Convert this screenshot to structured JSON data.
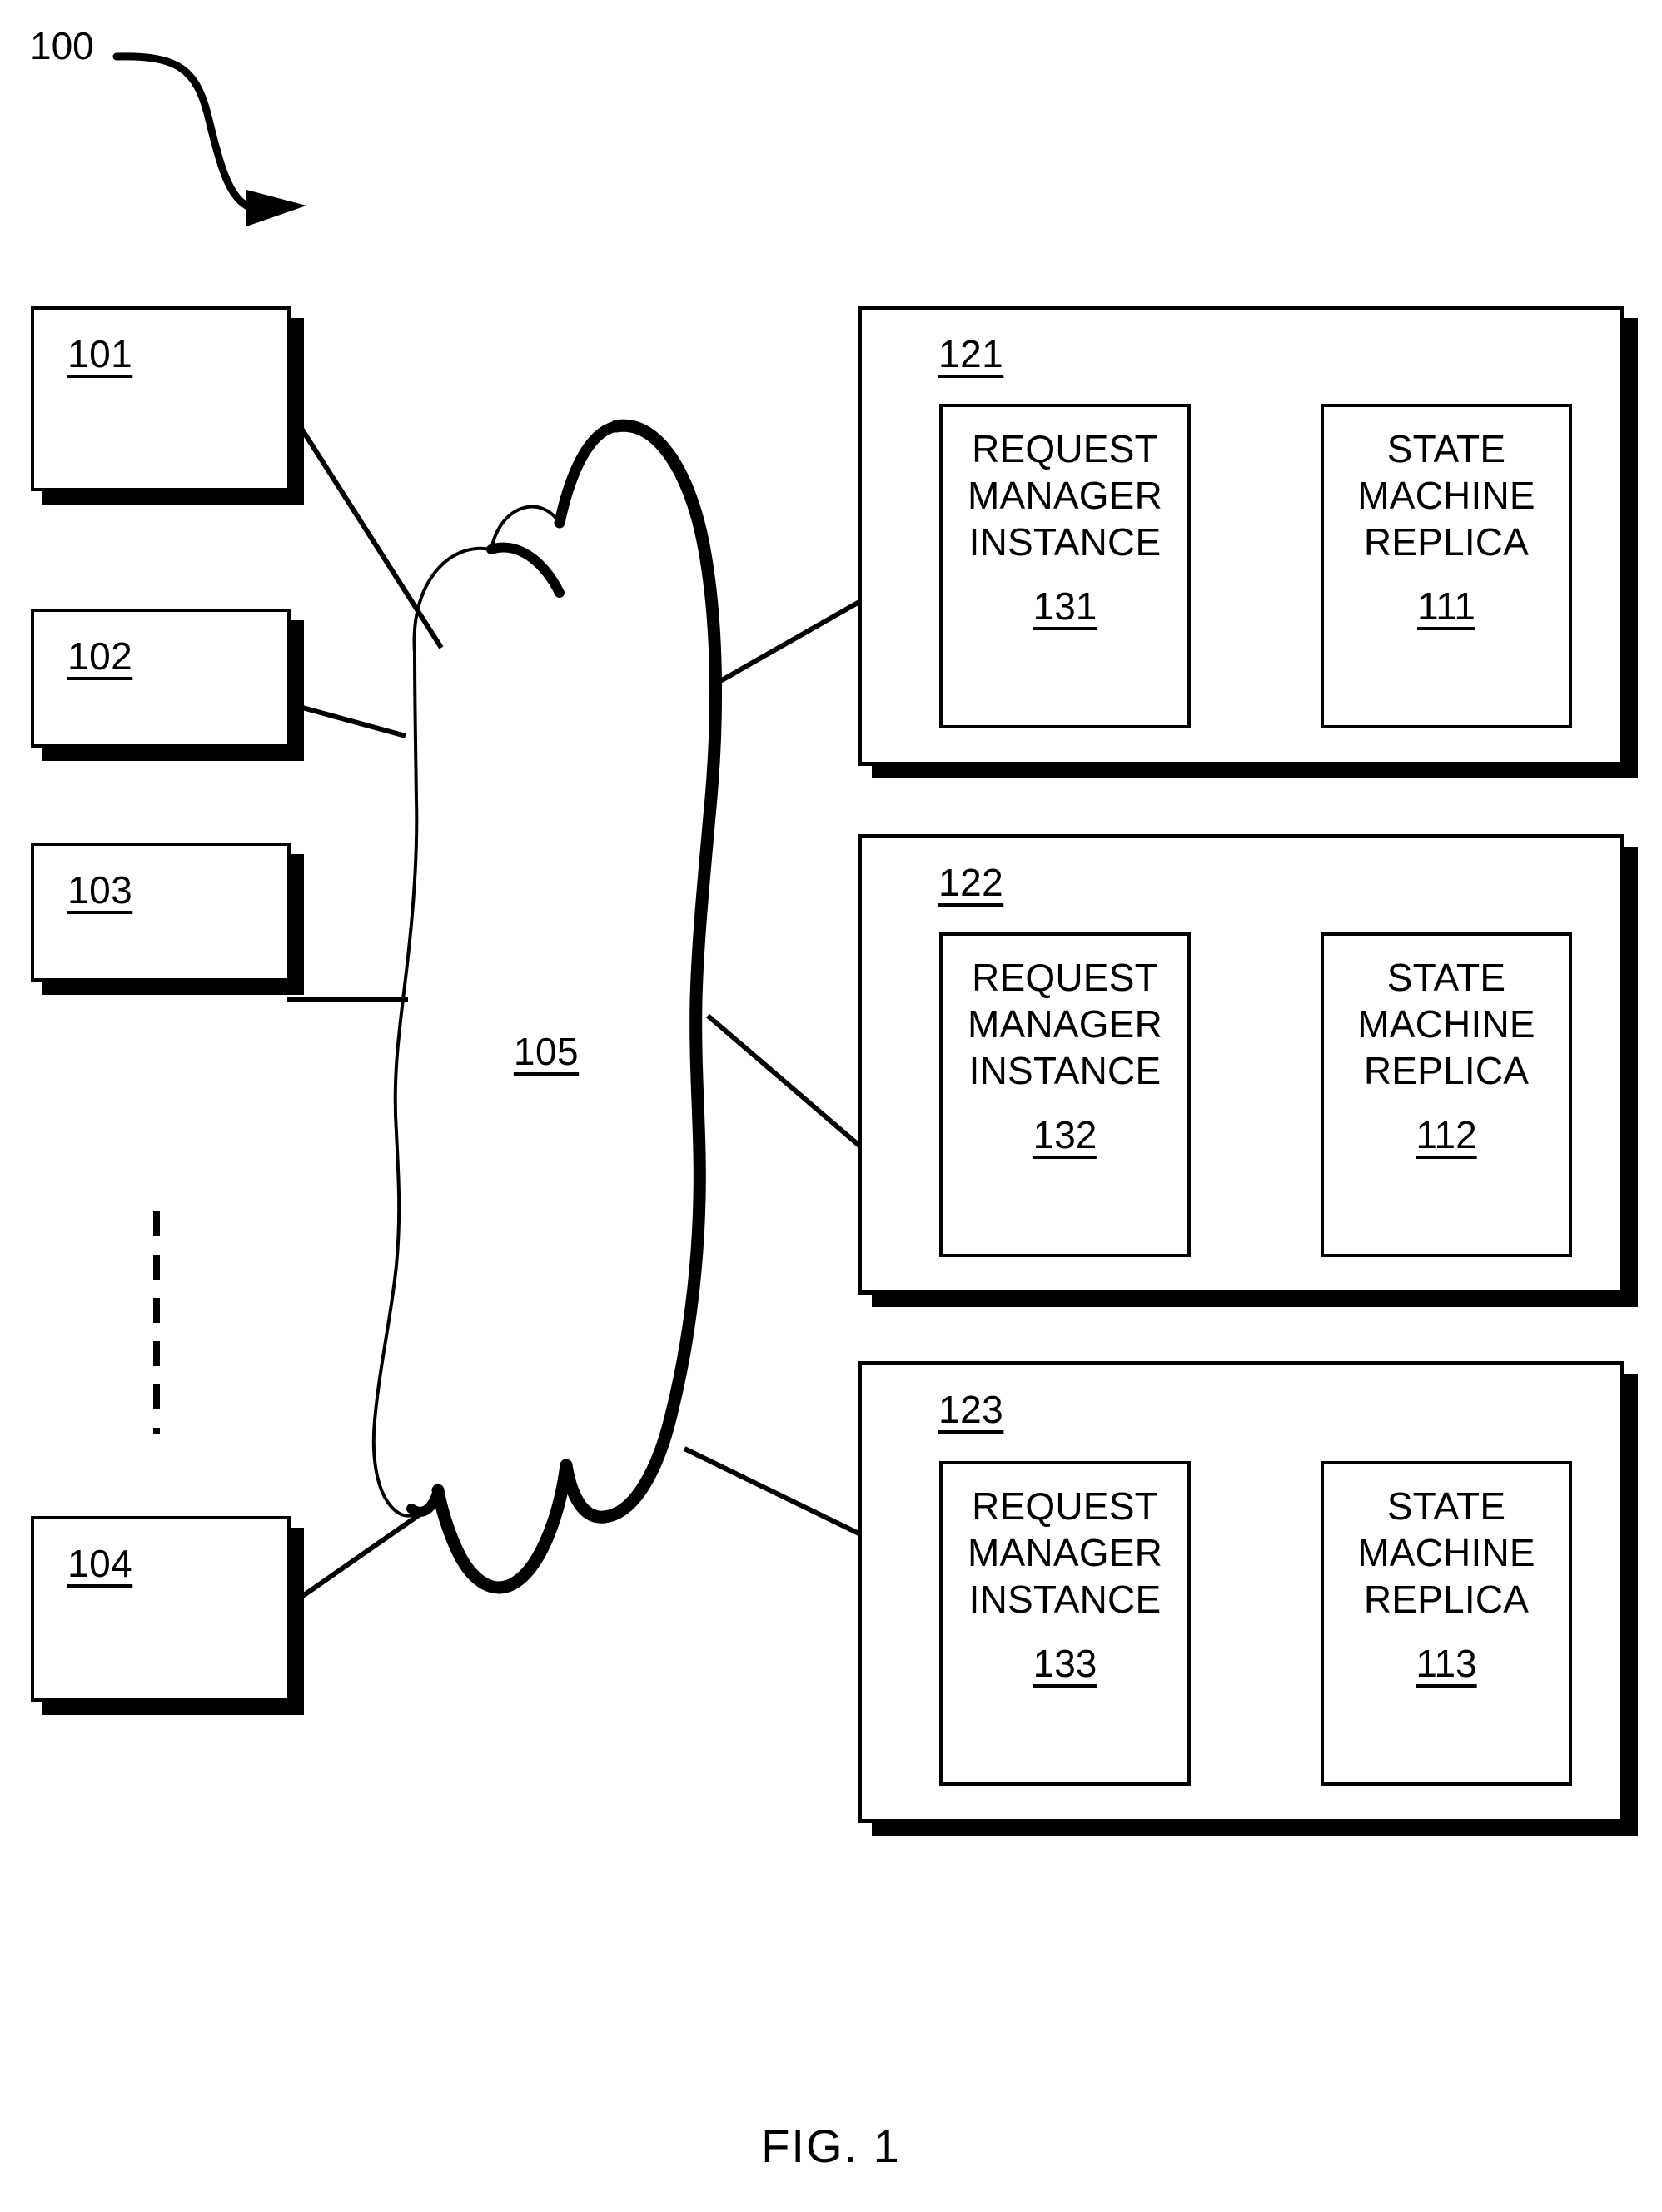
{
  "figure": {
    "overall_ref": "100",
    "caption": "FIG. 1",
    "network_ref": "105"
  },
  "clients": [
    {
      "ref": "101",
      "name": "client-box-101"
    },
    {
      "ref": "102",
      "name": "client-box-102"
    },
    {
      "ref": "103",
      "name": "client-box-103"
    },
    {
      "ref": "104",
      "name": "client-box-104"
    }
  ],
  "nodes": [
    {
      "panel_ref": "121",
      "request_manager": {
        "title": "REQUEST\nMANAGER\nINSTANCE",
        "ref": "131"
      },
      "state_machine": {
        "title": "STATE\nMACHINE\nREPLICA",
        "ref": "111"
      }
    },
    {
      "panel_ref": "122",
      "request_manager": {
        "title": "REQUEST\nMANAGER\nINSTANCE",
        "ref": "132"
      },
      "state_machine": {
        "title": "STATE\nMACHINE\nREPLICA",
        "ref": "112"
      }
    },
    {
      "panel_ref": "123",
      "request_manager": {
        "title": "REQUEST\nMANAGER\nINSTANCE",
        "ref": "133"
      },
      "state_machine": {
        "title": "STATE\nMACHINE\nREPLICA",
        "ref": "113"
      }
    }
  ],
  "colors": {
    "ink": "#000000",
    "paper": "#ffffff"
  }
}
